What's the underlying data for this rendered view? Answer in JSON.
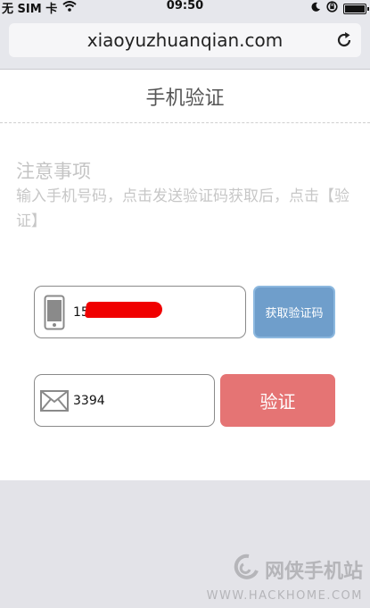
{
  "status_bar": {
    "carrier": "无 SIM 卡",
    "time": "09:50"
  },
  "browser": {
    "url": "xiaoyuzhuanqian.com"
  },
  "page": {
    "title": "手机验证"
  },
  "notice": {
    "title": "注意事项",
    "text": "输入手机号码，点击发送验证码获取后，点击【验证】"
  },
  "form": {
    "phone_value": "15",
    "get_code_label": "获取验证码",
    "code_value": "3394",
    "verify_label": "验证"
  },
  "watermark": {
    "name": "网侠手机站",
    "url": "WWW.HACKHOME.COM"
  },
  "colors": {
    "get_code": "#6f9ecb",
    "verify": "#e57474",
    "redaction": "#f00000"
  }
}
